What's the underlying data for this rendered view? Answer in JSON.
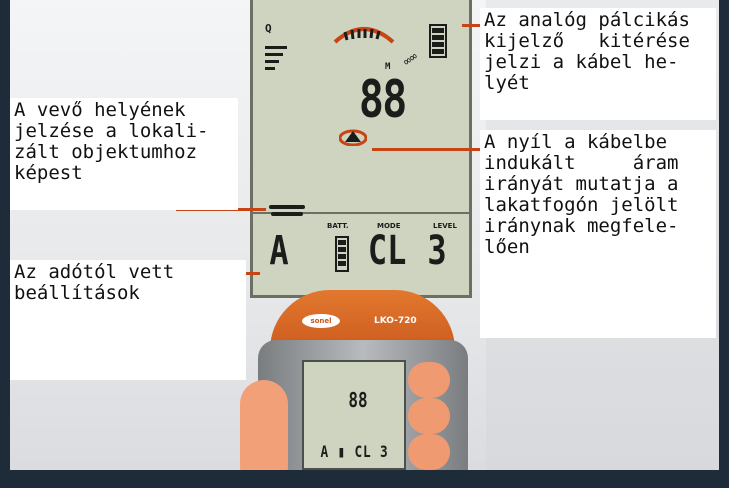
{
  "callouts": {
    "analog_lines": [
      "Az analóg pálcikás",
      "kijelző   kitérése",
      "jelzi a kábel he-",
      "lyét"
    ],
    "arrow_lines": [
      "A nyíl a kábelbe",
      "indukált     áram",
      "irányát mutatja a",
      "lakatfogón jelölt",
      "iránynak megfele-",
      "lően"
    ],
    "receiver_lines": [
      "A vevő helyének",
      "jelzése a lokali-",
      "zált objektumhoz",
      "képest"
    ],
    "settings_lines": [
      "Az adótól vett",
      "beállítások"
    ]
  },
  "lcd": {
    "q_label": "Q",
    "reading": "88",
    "m_label": "M",
    "batt_label": "BATT.",
    "mode_label": "MODE",
    "level_label": "LEVEL",
    "mode_letter": "A",
    "mode_value": "CL",
    "level_value": "3"
  },
  "device": {
    "model": "LKO-720",
    "brand": "sonel",
    "mini_reading": "88",
    "mini_row": "A ▮ CL 3"
  },
  "colors": {
    "lcd_bg": "#cfd4c0",
    "leader_line": "#c74415",
    "device_orange": "#e2782e",
    "frame": "#1e2b38"
  }
}
